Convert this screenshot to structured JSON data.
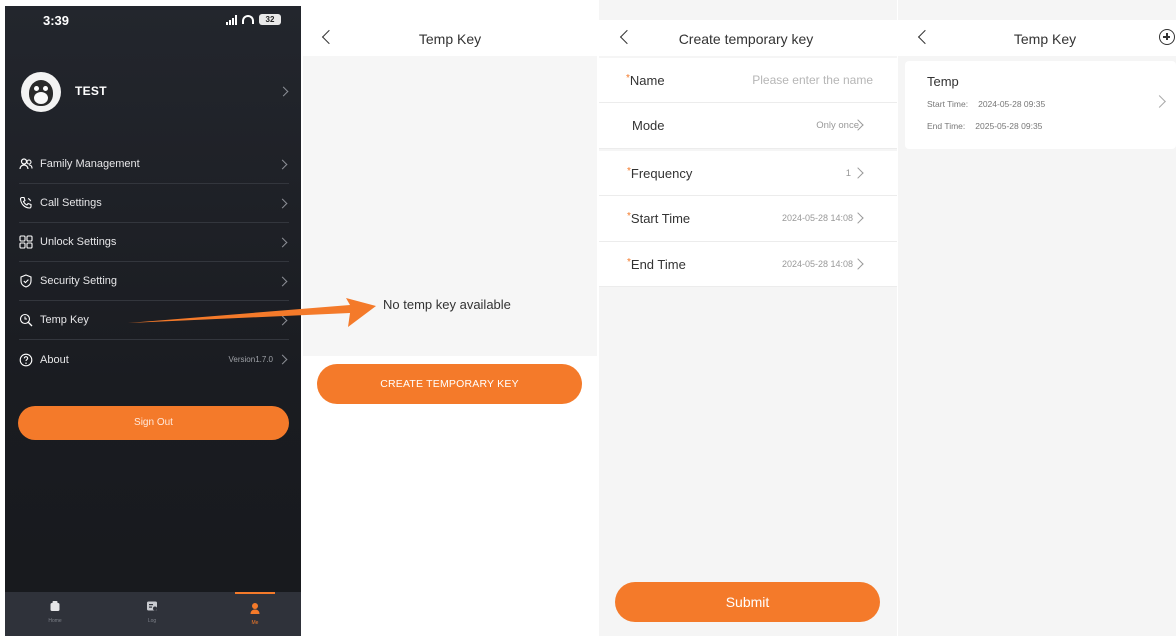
{
  "settings_screen": {
    "status_time": "3:39",
    "battery": "32",
    "profile_name": "TEST",
    "menu": [
      {
        "label": "Family Management",
        "icon": "people-icon",
        "value": ""
      },
      {
        "label": "Call Settings",
        "icon": "phone-icon",
        "value": ""
      },
      {
        "label": "Unlock Settings",
        "icon": "grid-icon",
        "value": ""
      },
      {
        "label": "Security Setting",
        "icon": "shield-icon",
        "value": ""
      },
      {
        "label": "Temp Key",
        "icon": "key-icon",
        "value": ""
      },
      {
        "label": "About",
        "icon": "question-icon",
        "value": "Version1.7.0"
      }
    ],
    "sign_out": "Sign Out",
    "tabs": [
      {
        "label": "Home",
        "icon": "home-icon"
      },
      {
        "label": "Log",
        "icon": "log-icon"
      },
      {
        "label": "Me",
        "icon": "person-icon",
        "active": true
      }
    ],
    "accent_color": "#f47a2a"
  },
  "temp_key_empty": {
    "title": "Temp Key",
    "empty_message": "No temp key available",
    "create_button": "CREATE TEMPORARY KEY"
  },
  "create_key": {
    "title": "Create temporary key",
    "fields": {
      "name": {
        "label": "Name",
        "placeholder": "Please enter the name"
      },
      "mode": {
        "label": "Mode",
        "value": "Only once"
      },
      "frequency": {
        "label": "Frequency",
        "value": "1"
      },
      "start_time": {
        "label": "Start Time",
        "value": "2024-05-28  14:08"
      },
      "end_time": {
        "label": "End Time",
        "value": "2024-05-28  14:08"
      }
    },
    "required_mark": "*",
    "submit": "Submit"
  },
  "temp_key_list": {
    "title": "Temp Key",
    "keys": [
      {
        "name": "Temp",
        "start_label": "Start Time:",
        "start_value": "2024-05-28  09:35",
        "end_label": "End Time:",
        "end_value": "2025-05-28  09:35"
      }
    ]
  }
}
